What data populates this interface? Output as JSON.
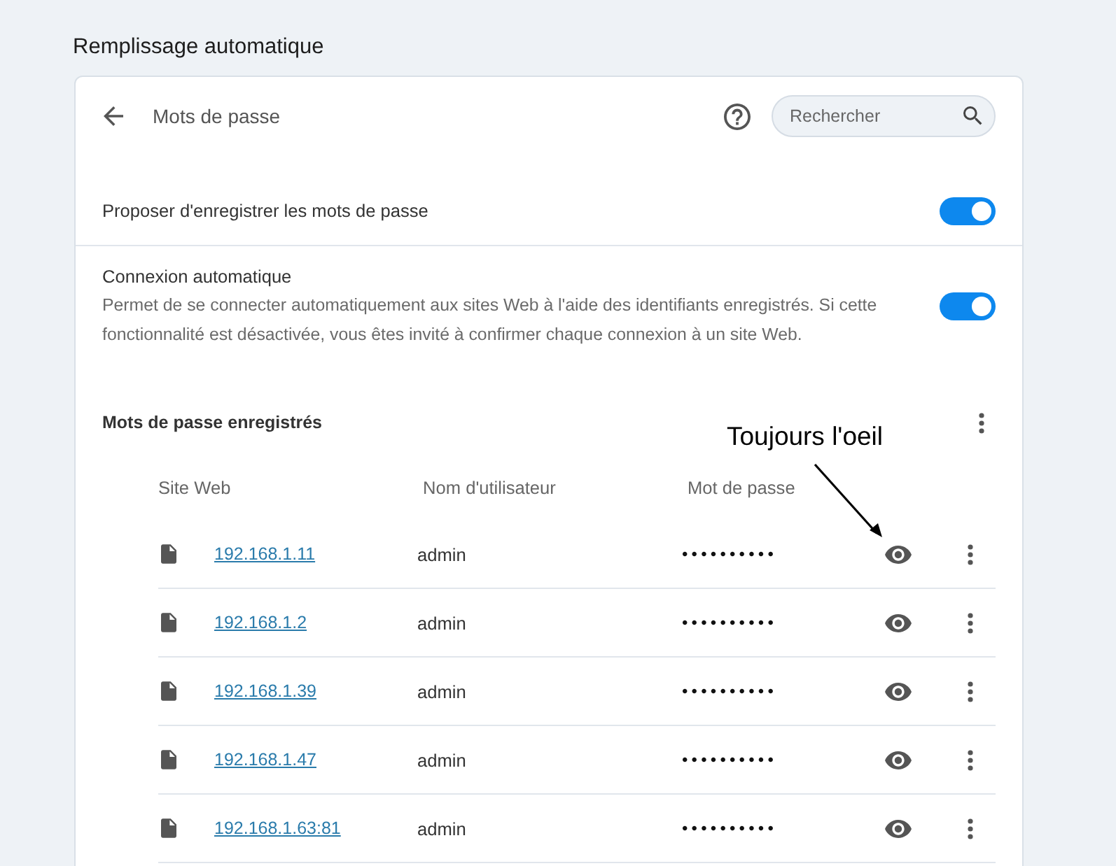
{
  "page": {
    "title": "Remplissage automatique"
  },
  "header": {
    "title": "Mots de passe",
    "search": {
      "placeholder": "Rechercher"
    }
  },
  "settings": [
    {
      "label": "Proposer d'enregistrer les mots de passe",
      "on": true
    },
    {
      "label": "Connexion automatique",
      "description": "Permet de se connecter automatiquement aux sites Web à l'aide des identifiants enregistrés. Si cette fonctionnalité est désactivée, vous êtes invité à confirmer chaque connexion à un site Web.",
      "on": true
    }
  ],
  "saved_passwords": {
    "title": "Mots de passe enregistrés",
    "columns": [
      "Site Web",
      "Nom d'utilisateur",
      "Mot de passe"
    ],
    "rows": [
      {
        "site": "192.168.1.11",
        "username": "admin",
        "password": "••••••••••"
      },
      {
        "site": "192.168.1.2",
        "username": "admin",
        "password": "••••••••••"
      },
      {
        "site": "192.168.1.39",
        "username": "admin",
        "password": "••••••••••"
      },
      {
        "site": "192.168.1.47",
        "username": "admin",
        "password": "••••••••••"
      },
      {
        "site": "192.168.1.63:81",
        "username": "admin",
        "password": "••••••••••"
      }
    ]
  },
  "annotation": {
    "text": "Toujours l'oeil"
  }
}
